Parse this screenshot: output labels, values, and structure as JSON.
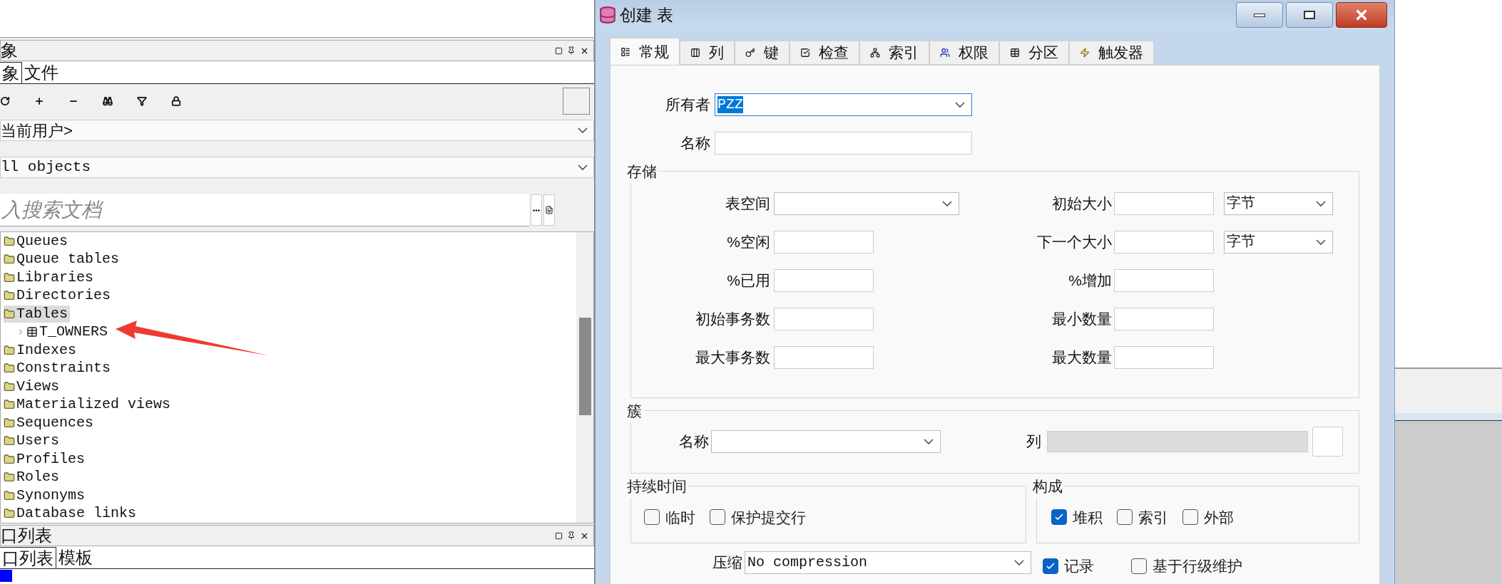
{
  "left_panel": {
    "header": {
      "title": "象"
    },
    "tabs": [
      {
        "label": "象",
        "selected": true
      },
      {
        "label": "文件",
        "selected": false
      }
    ],
    "owner_dropdown": {
      "value": "当前用户>"
    },
    "filter_dropdown": {
      "value": "ll objects"
    },
    "search": {
      "placeholder": "入搜索文档"
    },
    "tree": [
      {
        "label": "Queues",
        "kind": "folder",
        "selected": false
      },
      {
        "label": "Queue tables",
        "kind": "folder",
        "selected": false
      },
      {
        "label": "Libraries",
        "kind": "folder",
        "selected": false
      },
      {
        "label": "Directories",
        "kind": "folder",
        "selected": false
      },
      {
        "label": "Tables",
        "kind": "folder",
        "selected": true,
        "children": [
          {
            "label": "T_OWNERS",
            "kind": "table",
            "selected": false,
            "expanded": false
          }
        ]
      },
      {
        "label": "Indexes",
        "kind": "folder",
        "selected": false
      },
      {
        "label": "Constraints",
        "kind": "folder",
        "selected": false
      },
      {
        "label": "Views",
        "kind": "folder",
        "selected": false
      },
      {
        "label": "Materialized views",
        "kind": "folder",
        "selected": false
      },
      {
        "label": "Sequences",
        "kind": "folder",
        "selected": false
      },
      {
        "label": "Users",
        "kind": "folder",
        "selected": false
      },
      {
        "label": "Profiles",
        "kind": "folder",
        "selected": false
      },
      {
        "label": "Roles",
        "kind": "folder",
        "selected": false
      },
      {
        "label": "Synonyms",
        "kind": "folder",
        "selected": false
      },
      {
        "label": "Database links",
        "kind": "folder",
        "selected": false
      }
    ]
  },
  "bottom_panel": {
    "title": "口列表",
    "tabs": [
      {
        "label": "口列表",
        "selected": true
      },
      {
        "label": "模板",
        "selected": false
      }
    ]
  },
  "dialog": {
    "title": "创建 表",
    "tabs": [
      {
        "label": "常规",
        "kind": "general",
        "selected": true
      },
      {
        "label": "列",
        "kind": "columns",
        "selected": false
      },
      {
        "label": "键",
        "kind": "keys",
        "selected": false
      },
      {
        "label": "检查",
        "kind": "checks",
        "selected": false
      },
      {
        "label": "索引",
        "kind": "indexes",
        "selected": false
      },
      {
        "label": "权限",
        "kind": "privileges",
        "selected": false
      },
      {
        "label": "分区",
        "kind": "partitions",
        "selected": false
      },
      {
        "label": "触发器",
        "kind": "triggers",
        "selected": false
      }
    ],
    "owner": {
      "label": "所有者",
      "value": "PZZ"
    },
    "name": {
      "label": "名称"
    },
    "storage": {
      "title": "存储",
      "rows": [
        {
          "left": {
            "label": "表空间",
            "kind": "select"
          },
          "right": {
            "label": "初始大小",
            "unit": "字节"
          }
        },
        {
          "left": {
            "label": "%空闲",
            "kind": "text"
          },
          "right": {
            "label": "下一个大小",
            "unit": "字节"
          }
        },
        {
          "left": {
            "label": "%已用",
            "kind": "text"
          },
          "right": {
            "label": "%增加"
          }
        },
        {
          "left": {
            "label": "初始事务数",
            "kind": "text"
          },
          "right": {
            "label": "最小数量"
          }
        },
        {
          "left": {
            "label": "最大事务数",
            "kind": "text"
          },
          "right": {
            "label": "最大数量"
          }
        }
      ]
    },
    "cluster": {
      "title": "簇",
      "name_label": "名称",
      "columns_label": "列"
    },
    "duration": {
      "title": "持续时间",
      "options": [
        {
          "label": "临时",
          "checked": false
        },
        {
          "label": "保护提交行",
          "checked": false
        }
      ]
    },
    "organization": {
      "title": "构成",
      "options": [
        {
          "label": "堆积",
          "checked": true
        },
        {
          "label": "索引",
          "checked": false
        },
        {
          "label": "外部",
          "checked": false
        }
      ]
    },
    "compression": {
      "label": "压缩",
      "value": "No compression"
    },
    "logging": {
      "label": "记录",
      "checked": true
    },
    "row_level": {
      "label": "基于行级维护",
      "checked": false
    }
  }
}
